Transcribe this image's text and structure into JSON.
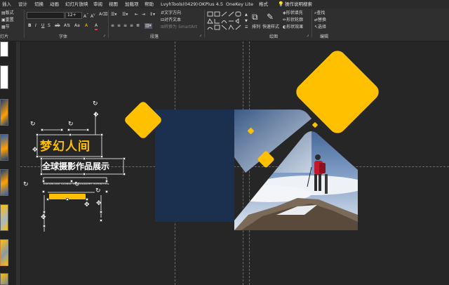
{
  "menu": [
    "插入",
    "设计",
    "切换",
    "动画",
    "幻灯片放映",
    "审阅",
    "视图",
    "加载项",
    "帮助",
    "LvyhTools(0429)",
    "OKPlus 4.5",
    "OneKey Lite",
    "格式",
    "操作说明搜索"
  ],
  "ribbon": {
    "layout_label": "版式",
    "reset_label": "重置",
    "section_label": "节",
    "font_size": "12+",
    "text_direction": "文字方向",
    "align_text": "对齐文本",
    "convert_smartart": "转换为 SmartArt",
    "arrange": "排列",
    "quick_styles": "快速样式",
    "shape_fill": "形状填充",
    "shape_outline": "形状轮廓",
    "shape_effects": "形状效果",
    "find": "查找",
    "replace": "替换",
    "select": "选择",
    "group_slides": "灯片",
    "group_font": "字体",
    "group_paragraph": "段落",
    "group_drawing": "绘图",
    "group_editing": "编辑",
    "font_buttons": [
      "B",
      "I",
      "U",
      "S",
      "ab",
      "A⇅",
      "Aa",
      "A",
      "A"
    ]
  },
  "slide": {
    "title_main": "梦幻人间",
    "title_sub": "全球摄影作品展示",
    "title_en": "DREAMLAND GLOBAL PHOTOGRAPHY EXHIBITION"
  },
  "colors": {
    "accent": "#ffc000",
    "navy": "#1b2f4e",
    "background": "#262626"
  }
}
